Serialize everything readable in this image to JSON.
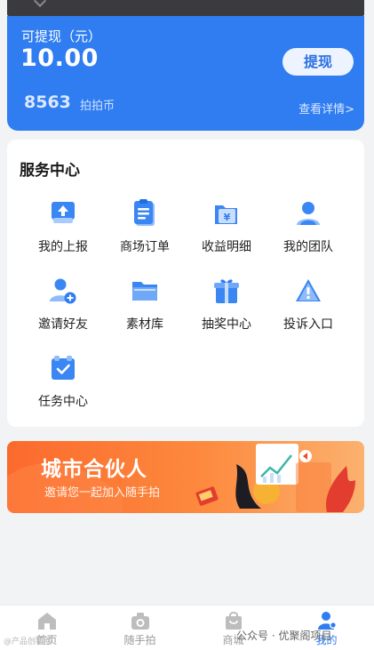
{
  "wallet": {
    "label": "可提现（元）",
    "amount": "10.00",
    "withdraw_label": "提现",
    "coins": "8563",
    "coins_unit": "拍拍币",
    "details_link": "查看详情>"
  },
  "service": {
    "title": "服务中心",
    "items": [
      {
        "label": "我的上报",
        "icon": "upload-report-icon"
      },
      {
        "label": "商场订单",
        "icon": "clipboard-order-icon"
      },
      {
        "label": "收益明细",
        "icon": "yen-folder-icon"
      },
      {
        "label": "我的团队",
        "icon": "person-icon"
      },
      {
        "label": "邀请好友",
        "icon": "add-friend-icon"
      },
      {
        "label": "素材库",
        "icon": "folder-icon"
      },
      {
        "label": "抽奖中心",
        "icon": "gift-icon"
      },
      {
        "label": "投诉入口",
        "icon": "warning-icon"
      },
      {
        "label": "任务中心",
        "icon": "task-check-icon"
      }
    ]
  },
  "banner": {
    "title": "城市合伙人",
    "subtitle": "邀请您一起加入随手拍"
  },
  "tabbar": [
    {
      "label": "首页",
      "icon": "home-icon",
      "active": false
    },
    {
      "label": "随手拍",
      "icon": "camera-icon",
      "active": false
    },
    {
      "label": "商城",
      "icon": "shopping-bag-icon",
      "active": false
    },
    {
      "label": "我的",
      "icon": "profile-icon",
      "active": true
    }
  ],
  "watermark": "公众号 · 优聚阁项目",
  "watermark_left": "@产品创新圈",
  "colors": {
    "accent": "#2f7df1",
    "banner_orange": "#fb6a2d",
    "background": "#f2f3f5"
  }
}
